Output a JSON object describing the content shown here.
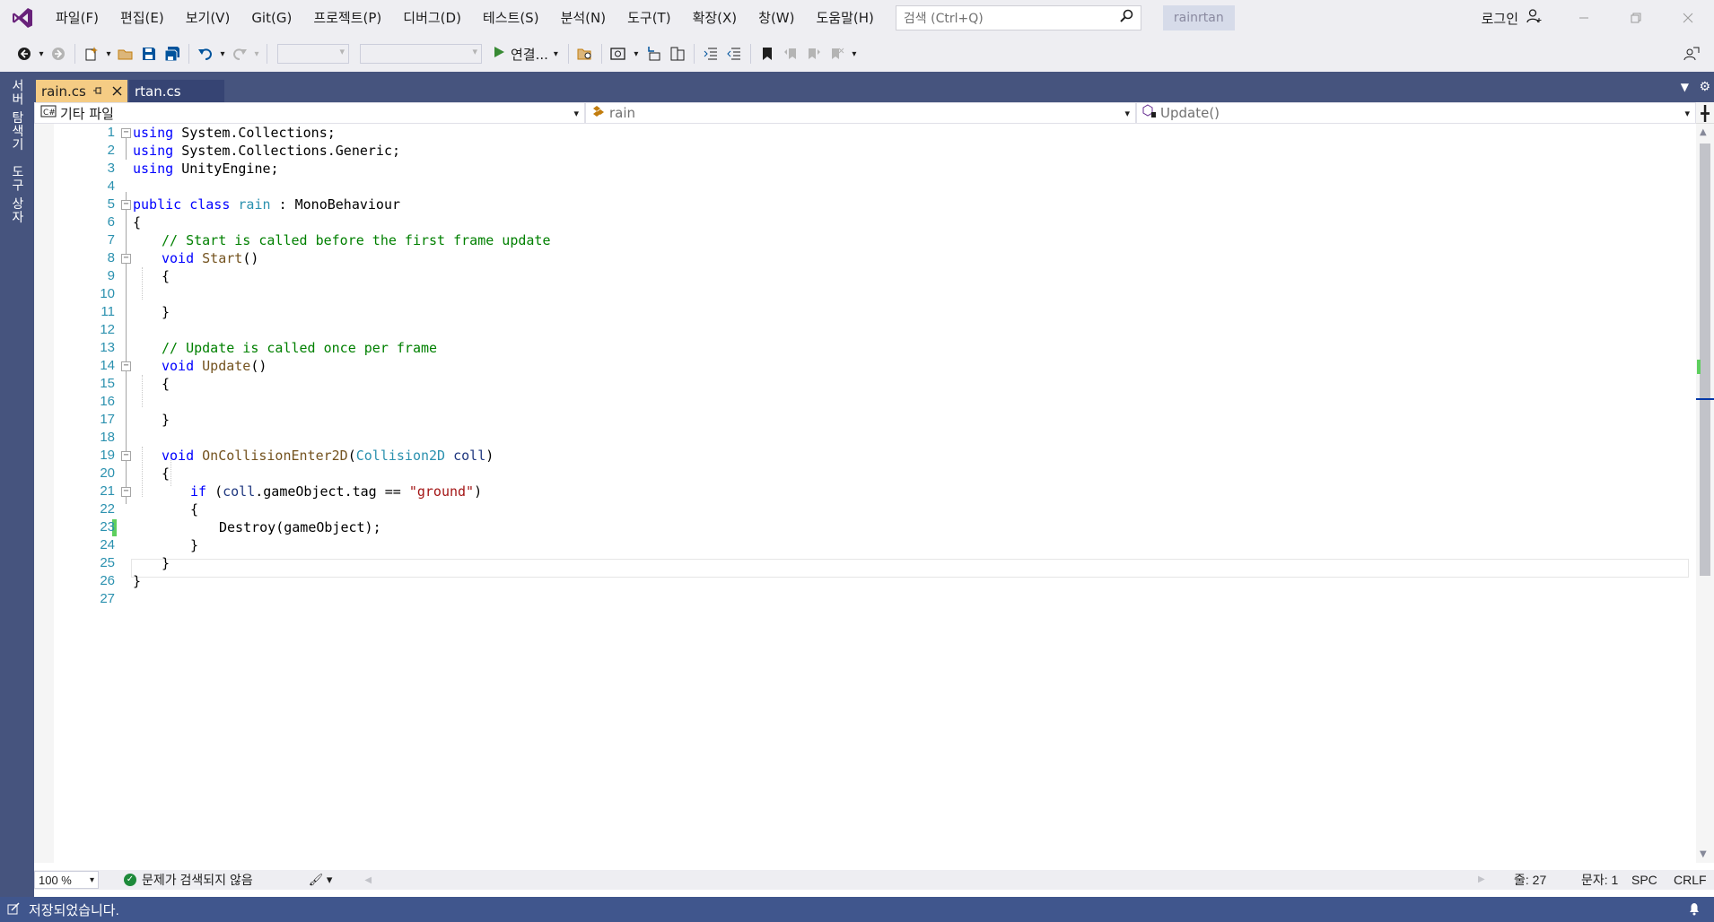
{
  "menu": [
    "파일(F)",
    "편집(E)",
    "보기(V)",
    "Git(G)",
    "프로젝트(P)",
    "디버그(D)",
    "테스트(S)",
    "분석(N)",
    "도구(T)",
    "확장(X)",
    "창(W)",
    "도움말(H)"
  ],
  "search": {
    "placeholder": "검색 (Ctrl+Q)"
  },
  "project_name": "rainrtan",
  "login_label": "로그인",
  "toolbar": {
    "run_label": "연결..."
  },
  "left_rail": {
    "server_explorer": "서버 탐색기",
    "toolbox": "도구 상자"
  },
  "tabs": [
    {
      "label": "rain.cs",
      "active": true
    },
    {
      "label": "rtan.cs",
      "active": false
    }
  ],
  "navbar": {
    "project": "기타 파일",
    "class": "rain",
    "member": "Update()"
  },
  "code_lines": [
    "1",
    "2",
    "3",
    "4",
    "5",
    "6",
    "7",
    "8",
    "9",
    "10",
    "11",
    "12",
    "13",
    "14",
    "15",
    "16",
    "17",
    "18",
    "19",
    "20",
    "21",
    "22",
    "23",
    "24",
    "25",
    "26",
    "27"
  ],
  "code": {
    "using1": "System.Collections;",
    "using2": "System.Collections.Generic;",
    "using3": "UnityEngine;",
    "kw_using": "using",
    "kw_public": "public",
    "kw_class": "class",
    "class_name": "rain",
    "base": ": MonoBehaviour",
    "brace_open": "{",
    "brace_close": "}",
    "comment_start": "// Start is called before the first frame update",
    "kw_void": "void",
    "m_start": "Start",
    "parens": "()",
    "comment_update": "// Update is called once per frame",
    "m_update": "Update",
    "m_collision": "OnCollisionEnter2D",
    "collision_type": "Collision2D",
    "param": "coll",
    "kw_if": "if",
    "if_expr": ".gameObject.tag ==",
    "str_ground": "\"ground\"",
    "destroy": "Destroy(gameObject);"
  },
  "status": {
    "zoom": "100 %",
    "issues": "문제가 검색되지 않음",
    "line": "줄: 27",
    "char": "문자: 1",
    "spc": "SPC",
    "crlf": "CRLF",
    "saved": "저장되었습니다."
  },
  "colors": {
    "accent": "#40568d",
    "tab_active": "#f5cc84",
    "keyword": "#0000ff",
    "type": "#2b91af",
    "comment": "#008000",
    "string": "#a31515"
  }
}
